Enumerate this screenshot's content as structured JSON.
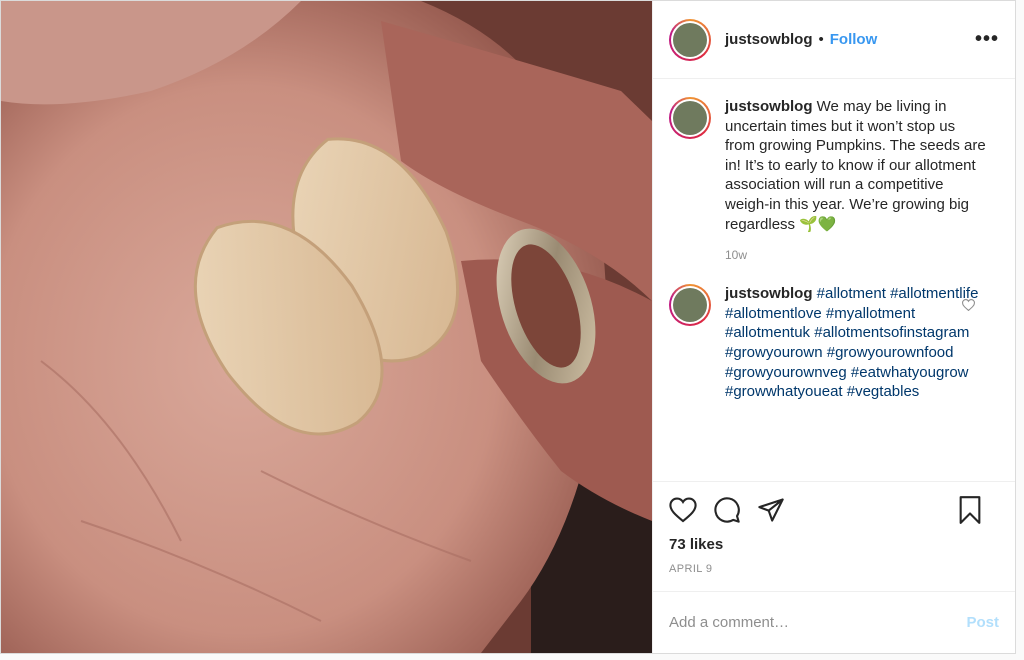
{
  "post": {
    "username": "justsowblog",
    "separator": "•",
    "follow_label": "Follow",
    "more_label": "•••"
  },
  "caption": {
    "username": "justsowblog",
    "text": "We may be living in uncertain times but it won’t stop us from growing Pumpkins. The seeds are in! It’s to early to know if our allotment association will run a competitive weigh-in this year. We’re growing big regardless 🌱💚",
    "time": "10w"
  },
  "hashtag_comment": {
    "username": "justsowblog",
    "tags": [
      "#allotment",
      "#allotmentlife",
      "#allotmentlove",
      "#myallotment",
      "#allotmentuk",
      "#allotmentsofinstagram",
      "#growyourown",
      "#growyourownfood",
      "#growyourownveg",
      "#eatwhatyougrow",
      "#growwhatyoueat",
      "#vegtables"
    ]
  },
  "engagement": {
    "likes": "73 likes",
    "date": "APRIL 9"
  },
  "comment_box": {
    "placeholder": "Add a comment…",
    "post_label": "Post"
  },
  "colors": {
    "link": "#00376b",
    "follow": "#3897f0",
    "post_disabled": "#b2dffc"
  },
  "icons": [
    "heart-icon",
    "comment-icon",
    "share-icon",
    "bookmark-icon",
    "more-icon"
  ]
}
